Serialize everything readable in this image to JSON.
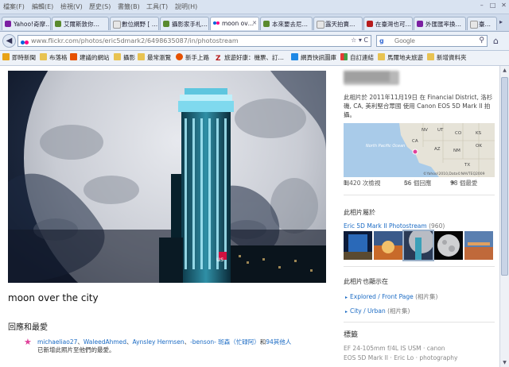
{
  "menubar": {
    "items": [
      "檔案(F)",
      "編輯(E)",
      "檢視(V)",
      "歷史(S)",
      "書籤(B)",
      "工具(T)",
      "說明(H)"
    ]
  },
  "tabs": [
    {
      "label": "Yahoo!奇摩…",
      "color": "#7b1fa2"
    },
    {
      "label": "艾爾斯敦你…",
      "color": "#5a8a2e"
    },
    {
      "label": "數位網野 [ …",
      "color": "#888888"
    },
    {
      "label": "攝影家手札…",
      "color": "#5a8a2e"
    },
    {
      "label": "moon ov…",
      "color": "#e0409a"
    },
    {
      "label": "本來要去尼…",
      "color": "#5a8a2e"
    },
    {
      "label": "露天拍賣…",
      "color": "#888888"
    },
    {
      "label": "在臺灣也可…",
      "color": "#b71c1c"
    },
    {
      "label": "外匯匯率換…",
      "color": "#7b1fa2"
    },
    {
      "label": "臺…",
      "color": "#888888"
    }
  ],
  "nav": {
    "back_glyph": "◀",
    "url": "www.flickr.com/photos/eric5dmark2/6498635087/in/photostream",
    "url_actions": "☆ ▾ C",
    "search_engine": "g",
    "search_placeholder": "Google",
    "search_icon": "⚲",
    "home_icon": "⌂"
  },
  "bookmarks": [
    {
      "label": "即時新聞",
      "color": "#e8a317"
    },
    {
      "label": "布落格",
      "color": "#e8c352"
    },
    {
      "label": "建議的網站",
      "color": "#e65100"
    },
    {
      "label": "攝影",
      "color": "#e8c352"
    },
    {
      "label": "最常瀏覽",
      "color": "#e8c352"
    },
    {
      "label": "新手上路",
      "color": "#e65100"
    },
    {
      "label": "旅遊好康：機票、訂…",
      "color": "#b71c1c"
    },
    {
      "label": "網頁快訊圖庫",
      "color": "#1e88e5"
    },
    {
      "label": "自訂連結",
      "color": "#1e88e5"
    },
    {
      "label": "馬爾地夫旅遊",
      "color": "#e8c352"
    },
    {
      "label": "新增資料夾",
      "color": "#e8c352"
    }
  ],
  "photo": {
    "title": "moon over the city",
    "sign": "us"
  },
  "faves": {
    "heading": "回應和最愛",
    "user1": "michaeliao27",
    "sep1": "、",
    "user2": "WaleedAhmed",
    "sep2": "、",
    "user3": "Aynsley Hermsen",
    "sep3": "、",
    "user4": "-benson- 斑森（忙碌阿）",
    "and": "和",
    "others": "94其他人",
    "suffix": "已新增此照片至他們的最愛。"
  },
  "sidebar": {
    "taken": "此相片於 2011年11月19日 在 Financial District, 洛杉磯, CA, 美利堅合眾國 使用 Canon EOS 5D Mark II 拍攝。",
    "map": {
      "ocean": "North Pacific Ocean",
      "states": [
        "NV",
        "UT",
        "CO",
        "KS",
        "CA",
        "AZ",
        "NM",
        "OK",
        "TX"
      ],
      "credit": "©Yahoo!2010,Data©NAVTEQ2009"
    },
    "stats": {
      "views": "1,420 次檢視",
      "comments": "56 個回應",
      "faves": "98 個最愛"
    },
    "belongs_heading": "此相片屬於",
    "set_name": "Eric 5D Mark II Photostream",
    "set_count": "(960)",
    "also_heading": "此相片也顯示在",
    "pools": [
      {
        "name": "Explored / Front Page",
        "kind": "(相片集)"
      },
      {
        "name": "City / Urban",
        "kind": "(相片集)"
      }
    ],
    "tags_heading": "標籤",
    "tags": [
      "EF 24-105mm f/4L IS USM",
      "canon",
      "EOS 5D Mark II",
      "Eric Lo",
      "photography"
    ]
  }
}
